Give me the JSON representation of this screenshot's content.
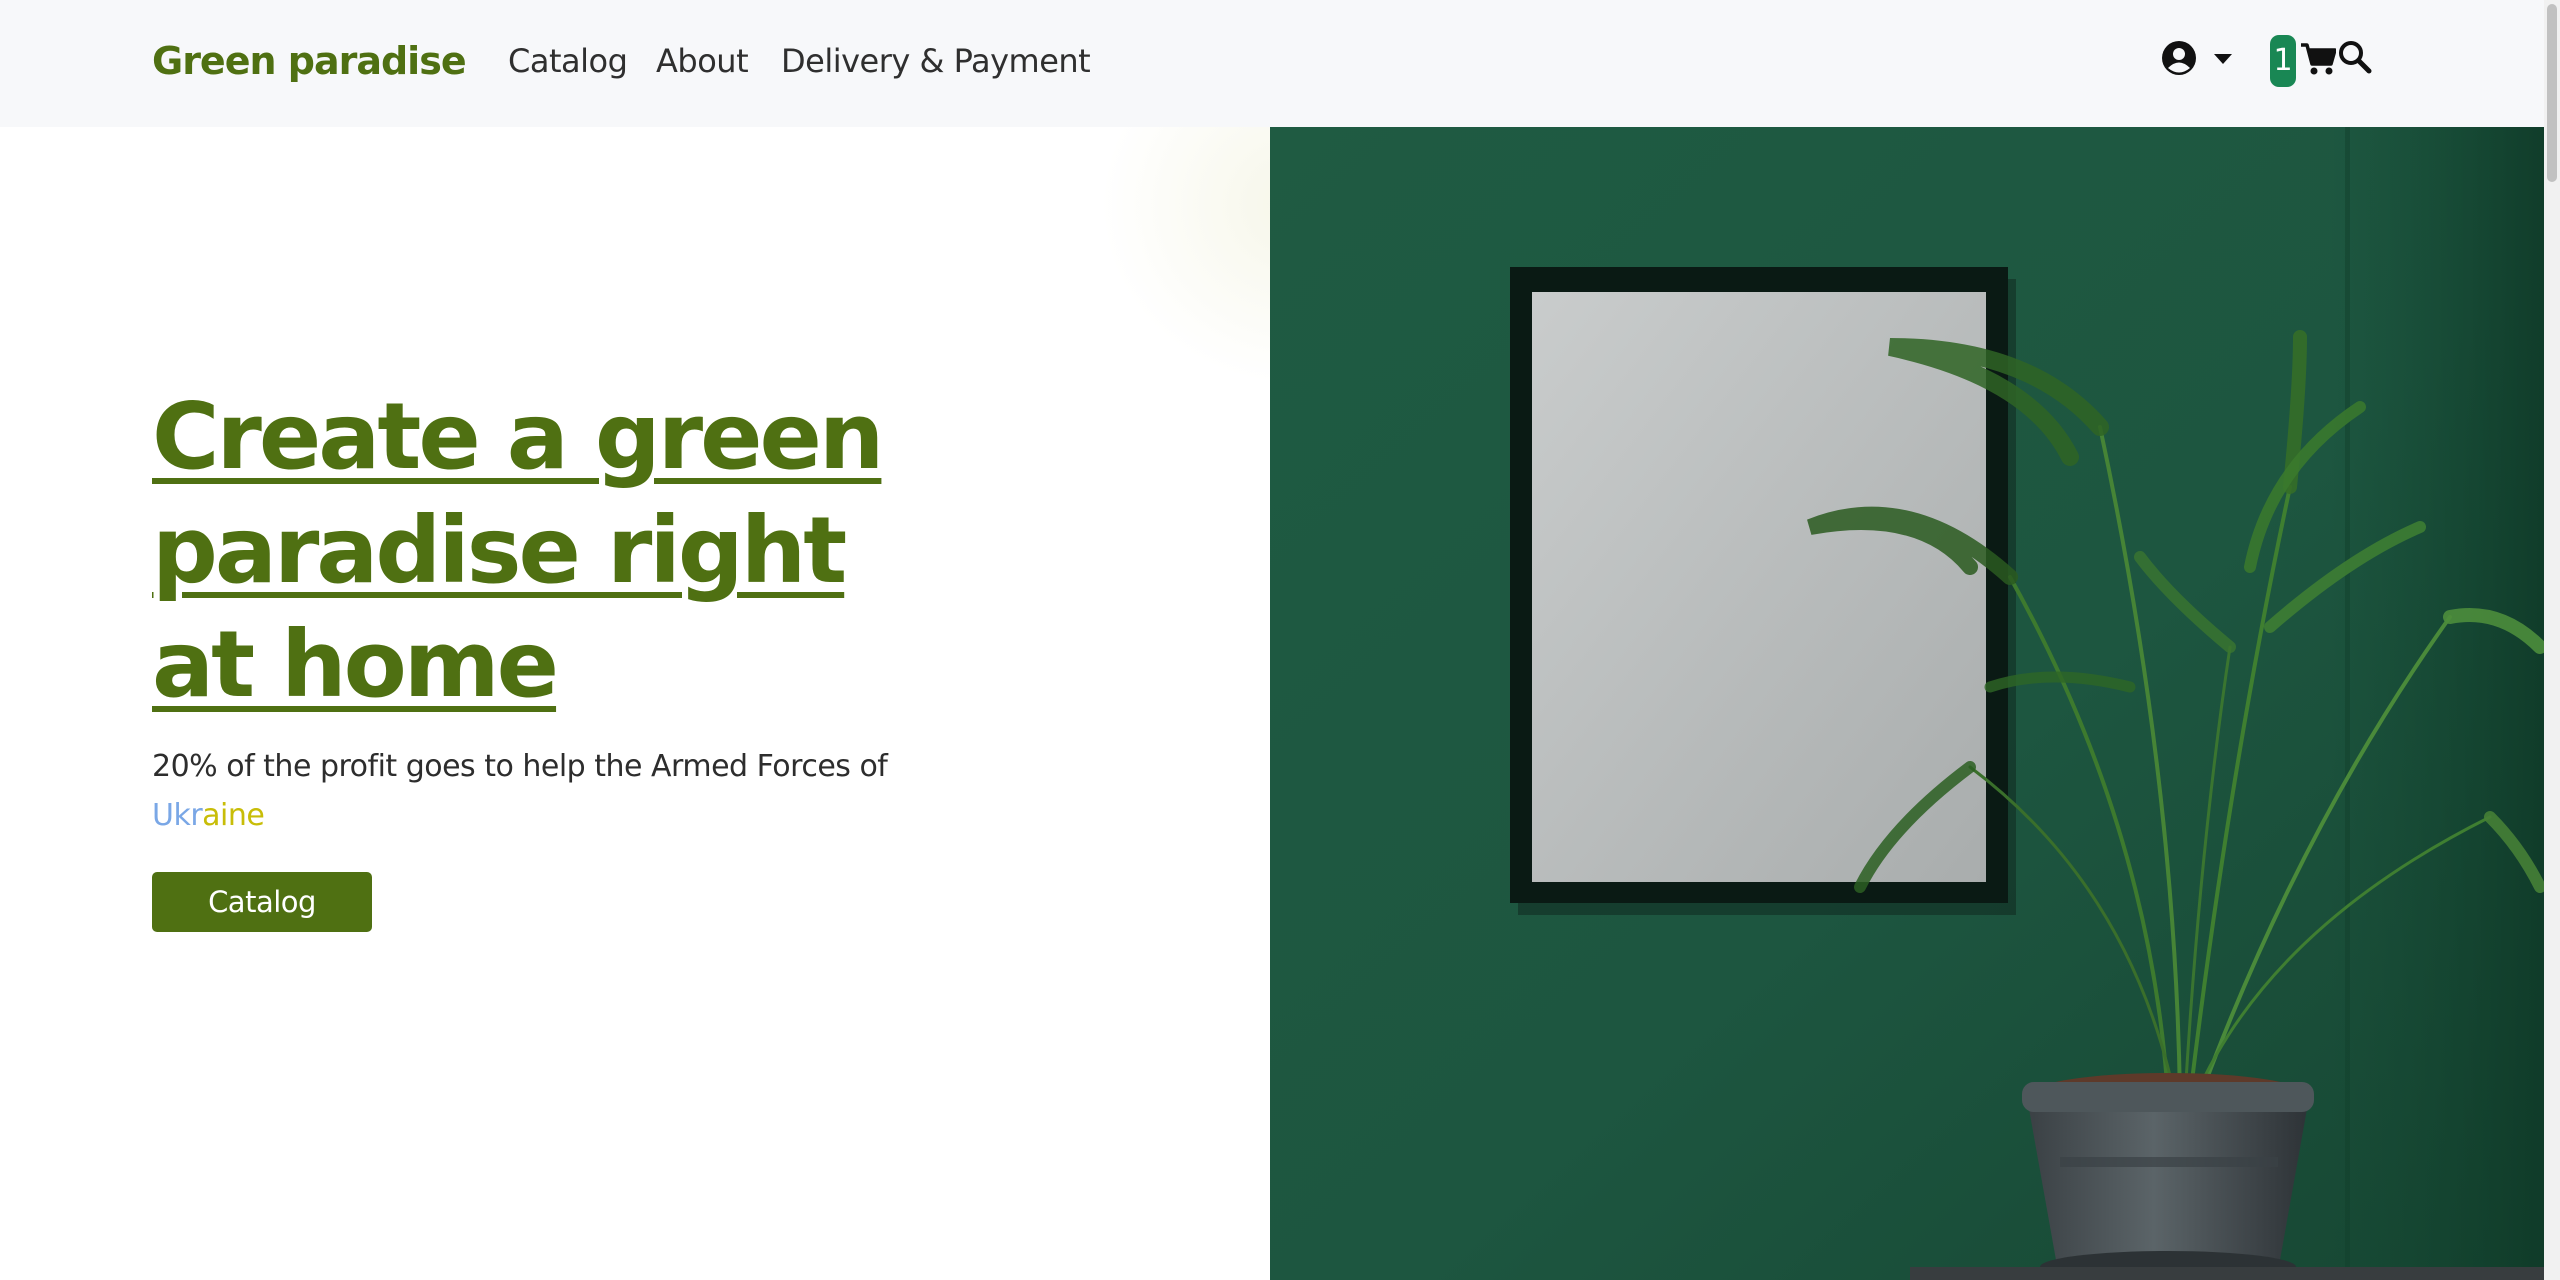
{
  "brand": {
    "name": "Green paradise"
  },
  "nav": {
    "links": [
      {
        "label": "Catalog"
      },
      {
        "label": "About"
      },
      {
        "label": "Delivery & Payment"
      }
    ],
    "cart_count": "1",
    "icons": [
      "user-circle-icon",
      "caret-down-icon",
      "cart-icon",
      "search-icon"
    ]
  },
  "hero": {
    "title": "Create a green paradise right at home",
    "subtitle_prefix": "20% of the profit goes to help the Armed Forces of ",
    "ukraine_part1": "Ukr",
    "ukraine_part2": "aine",
    "button_label": "Catalog",
    "image_description": "potted palm plant beside a blank framed picture on a dark green wall"
  },
  "colors": {
    "brand_green": "#4f7012",
    "badge_green": "#198754",
    "navbar_bg": "#f7f8fa",
    "ukraine_blue": "#7aa7e6",
    "ukraine_yellow": "#c8bd08",
    "wall_green": "#1f5a41"
  }
}
